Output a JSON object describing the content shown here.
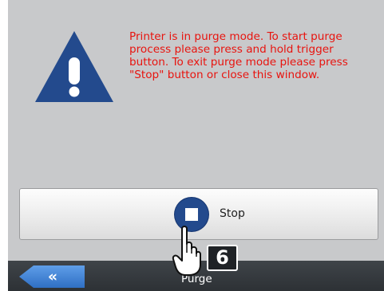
{
  "message": {
    "text": "Printer is in purge mode. To start purge\nprocess please press and hold trigger\nbutton. To exit purge mode please press\n\"Stop\" button or close this window."
  },
  "buttons": {
    "stop_label": "Stop"
  },
  "nav": {
    "back_label": "«",
    "title": "Purge"
  },
  "overlay": {
    "step_number": "6"
  },
  "icons": {
    "warning": "warning-icon",
    "stop": "stop-icon",
    "back": "double-chevron-left-icon",
    "hand": "hand-cursor-icon"
  },
  "colors": {
    "background": "#c8c9cb",
    "warning_blue": "#234a8d",
    "message_red": "#e8140f",
    "bottom_bar": "#34383c",
    "back_button_blue": "#3d7fd4"
  }
}
